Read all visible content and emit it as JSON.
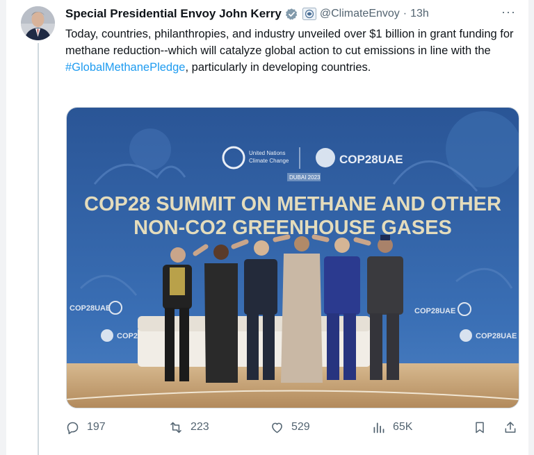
{
  "tweet": {
    "author_name": "Special Presidential Envoy John Kerry",
    "handle": "@ClimateEnvoy",
    "separator": "·",
    "time": "13h",
    "more_label": "···",
    "text_part1": "Today, countries, philanthropies, and industry unveiled over $1 billion in grant funding for methane reduction--which will catalyze global action to cut emissions in line with the ",
    "hashtag": "#GlobalMethanePledge",
    "text_part2": ", particularly in developing countries."
  },
  "media": {
    "banner_line1": "COP28 SUMMIT ON METHANE AND OTHER",
    "banner_line2": "NON-CO2 GREENHOUSE GASES",
    "un_label_1": "United Nations",
    "un_label_2": "Climate Change",
    "cop_label": "COP28UAE",
    "dubai_label": "DUBAI 2023"
  },
  "actions": {
    "replies": "197",
    "reposts": "223",
    "likes": "529",
    "views": "65K"
  },
  "colors": {
    "accent": "#1d9bf0",
    "muted": "#536471",
    "backdrop": "#2f5fa8"
  },
  "icons": {
    "verified": "verified-badge-icon",
    "flag": "government-flag-icon",
    "reply": "reply-icon",
    "repost": "repost-icon",
    "like": "heart-icon",
    "views": "views-chart-icon",
    "bookmark": "bookmark-icon",
    "share": "share-icon"
  }
}
